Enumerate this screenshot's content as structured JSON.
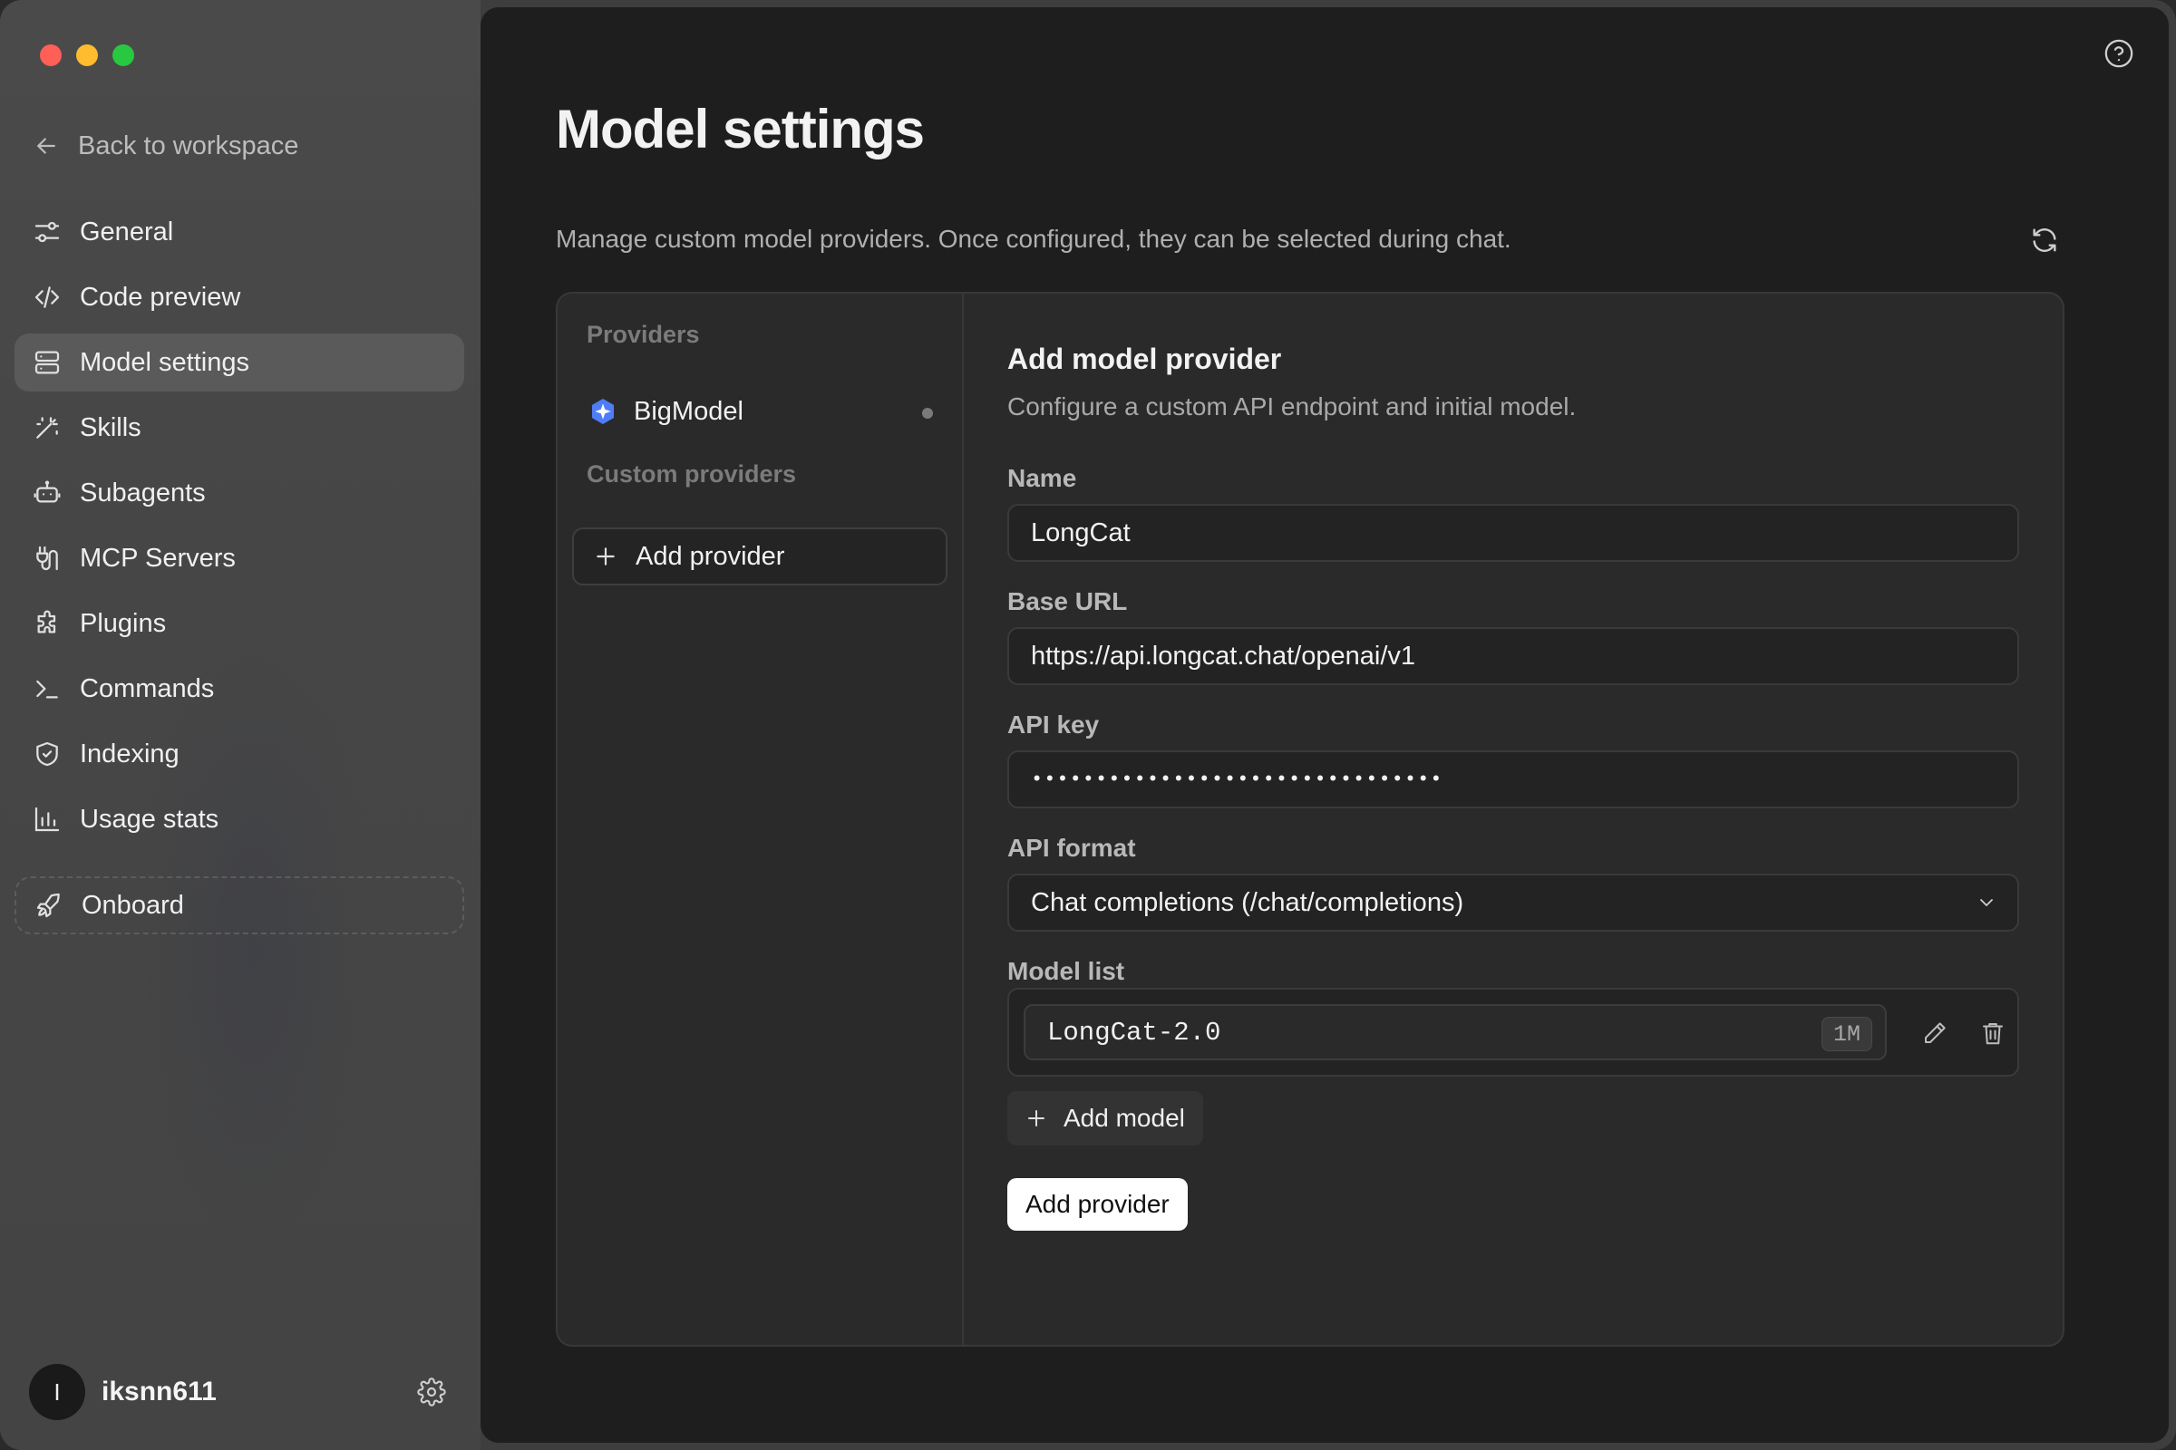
{
  "colors": {
    "sidebar_bg": "#464646",
    "main_bg": "#1e1e1e",
    "panel_bg": "#2a2a2a",
    "active_item": "#5a5a5a",
    "traffic_red": "#fe5f57",
    "traffic_yellow": "#febc2e",
    "traffic_green": "#28c840",
    "provider_logo": "#4f7cf7",
    "primary_button_bg": "#ffffff"
  },
  "sidebar": {
    "back_label": "Back to workspace",
    "items": [
      {
        "label": "General",
        "icon": "sliders-icon"
      },
      {
        "label": "Code preview",
        "icon": "code-icon"
      },
      {
        "label": "Model settings",
        "icon": "server-icon",
        "active": true
      },
      {
        "label": "Skills",
        "icon": "magic-wand-icon"
      },
      {
        "label": "Subagents",
        "icon": "robot-icon"
      },
      {
        "label": "MCP Servers",
        "icon": "plug-icon"
      },
      {
        "label": "Plugins",
        "icon": "puzzle-icon"
      },
      {
        "label": "Commands",
        "icon": "terminal-icon"
      },
      {
        "label": "Indexing",
        "icon": "shield-icon"
      },
      {
        "label": "Usage stats",
        "icon": "bar-chart-icon"
      }
    ],
    "onboard_label": "Onboard",
    "user": {
      "initial": "I",
      "name": "iksnn611"
    }
  },
  "main": {
    "title": "Model settings",
    "description": "Manage custom model providers. Once configured, they can be selected during chat.",
    "providers_label": "Providers",
    "providers": [
      {
        "name": "BigModel"
      }
    ],
    "custom_providers_label": "Custom providers",
    "add_provider_side_label": "Add provider",
    "form": {
      "title": "Add model provider",
      "description": "Configure a custom API endpoint and initial model.",
      "name_label": "Name",
      "name_value": "LongCat",
      "base_url_label": "Base URL",
      "base_url_value": "https://api.longcat.chat/openai/v1",
      "api_key_label": "API key",
      "api_key_value": "••••••••••••••••••••••••••••••••",
      "api_format_label": "API format",
      "api_format_value": "Chat completions (/chat/completions)",
      "model_list_label": "Model list",
      "models": [
        {
          "name": "LongCat-2.0",
          "context": "1M"
        }
      ],
      "add_model_label": "Add model",
      "submit_label": "Add provider"
    }
  }
}
